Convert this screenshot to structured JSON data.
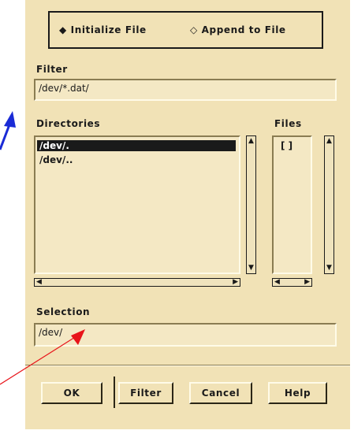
{
  "dialog": {
    "mode_options": [
      {
        "label": "Initialize File",
        "selected": true
      },
      {
        "label": "Append to File",
        "selected": false
      }
    ],
    "filter_label": "Filter",
    "filter_value": "/dev/*.dat/",
    "directories_label": "Directories",
    "directories": [
      "/dev/.",
      "/dev/.."
    ],
    "files_label": "Files",
    "files": [
      "[ ]"
    ],
    "selection_label": "Selection",
    "selection_value": "/dev/",
    "buttons": {
      "ok": "OK",
      "filter": "Filter",
      "cancel": "Cancel",
      "help": "Help"
    }
  },
  "icons": {
    "radio_selected": "diamond-filled-icon",
    "radio_unselected": "diamond-empty-icon"
  },
  "colors": {
    "dialog_bg": "#f1e2b6",
    "annotation_arrow_blue": "#1a2bd6",
    "annotation_arrow_red": "#e8141a"
  }
}
